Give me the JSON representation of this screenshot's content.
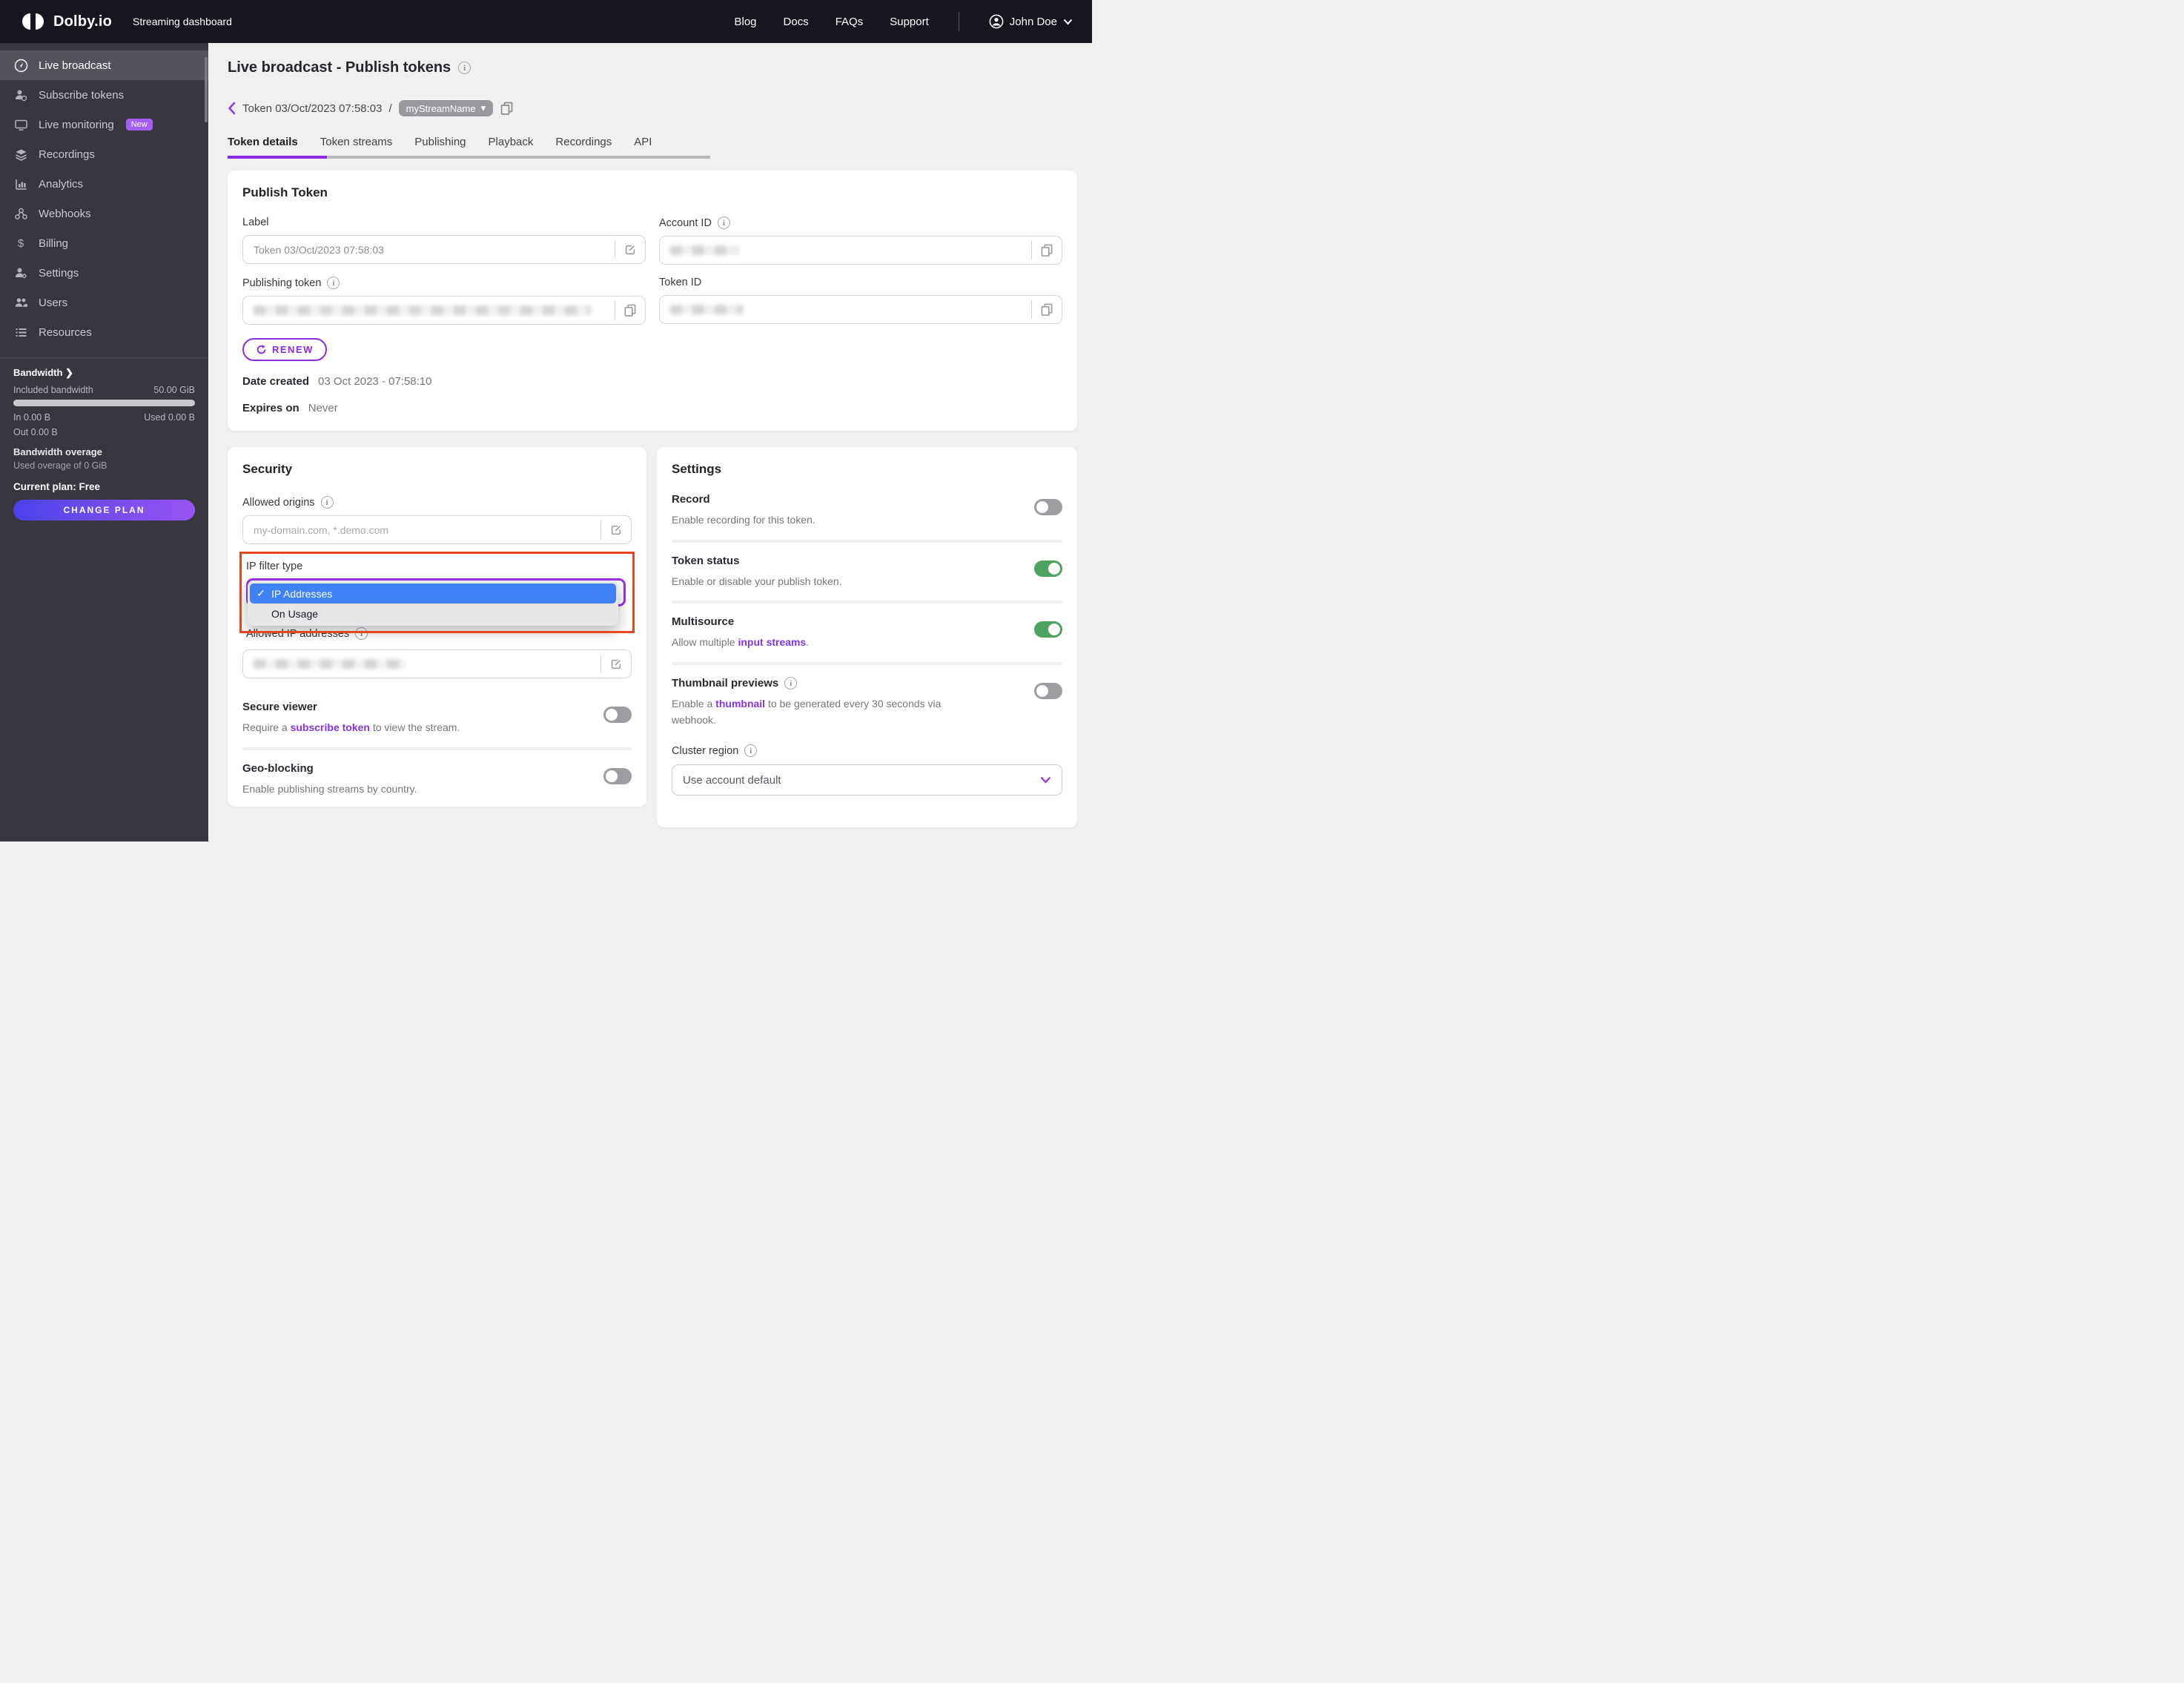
{
  "colors": {
    "accent_purple": "#8a2be2",
    "badge_purple": "#a45cf7",
    "highlight_red": "#e8441d",
    "select_focus_purple": "#9b30e8",
    "dropdown_selected_blue": "#3f82f7",
    "toggle_on_green": "#4da35f",
    "toggle_off_gray": "#9d9da1",
    "header_bg": "#17151d",
    "sidebar_bg": "#393640"
  },
  "icons": {
    "check": "✓",
    "caret_down": "▾",
    "dollar": "$"
  },
  "header": {
    "brand": "Dolby.io",
    "subtitle": "Streaming dashboard",
    "nav": [
      {
        "label": "Blog"
      },
      {
        "label": "Docs"
      },
      {
        "label": "FAQs"
      },
      {
        "label": "Support"
      }
    ],
    "user": "John Doe"
  },
  "sidebar": {
    "items": [
      {
        "label": "Live broadcast",
        "icon": "broadcast-icon",
        "active": true
      },
      {
        "label": "Subscribe tokens",
        "icon": "person-shield-icon"
      },
      {
        "label": "Live monitoring",
        "icon": "monitor-icon",
        "badge": "New"
      },
      {
        "label": "Recordings",
        "icon": "layers-icon"
      },
      {
        "label": "Analytics",
        "icon": "bar-chart-icon"
      },
      {
        "label": "Webhooks",
        "icon": "webhook-icon"
      },
      {
        "label": "Billing",
        "icon": "dollar-icon"
      },
      {
        "label": "Settings",
        "icon": "person-gear-icon"
      },
      {
        "label": "Users",
        "icon": "users-icon"
      },
      {
        "label": "Resources",
        "icon": "list-icon"
      }
    ],
    "bandwidth": {
      "title": "Bandwidth",
      "included_label": "Included bandwidth",
      "included_value": "50.00 GiB",
      "in": "In 0.00 B",
      "used": "Used 0.00 B",
      "out": "Out 0.00 B",
      "overage_title": "Bandwidth overage",
      "overage_detail": "Used overage of 0 GiB",
      "plan": "Current plan: Free",
      "change_plan": "CHANGE PLAN"
    }
  },
  "page": {
    "title": "Live broadcast - Publish tokens",
    "breadcrumb": {
      "token": "Token 03/Oct/2023 07:58:03",
      "separator": "/",
      "stream": "myStreamName"
    },
    "tabs": [
      {
        "label": "Token details",
        "active": true
      },
      {
        "label": "Token streams"
      },
      {
        "label": "Publishing"
      },
      {
        "label": "Playback"
      },
      {
        "label": "Recordings"
      },
      {
        "label": "API"
      }
    ]
  },
  "publish_token": {
    "title": "Publish Token",
    "label_label": "Label",
    "label_value": "Token 03/Oct/2023 07:58:03",
    "account_id_label": "Account ID",
    "publishing_token_label": "Publishing token",
    "token_id_label": "Token ID",
    "renew_label": "RENEW",
    "date_created_label": "Date created",
    "date_created_value": "03 Oct 2023 - 07:58:10",
    "expires_label": "Expires on",
    "expires_value": "Never"
  },
  "security": {
    "title": "Security",
    "allowed_origins_label": "Allowed origins",
    "allowed_origins_placeholder": "my-domain.com, *.demo.com",
    "ip_filter_label": "IP filter type",
    "ip_filter": {
      "selected": "IP Addresses",
      "options": [
        "IP Addresses",
        "On Usage"
      ]
    },
    "allowed_ip_label": "Allowed IP addresses",
    "secure_viewer": {
      "title": "Secure viewer",
      "enabled": false,
      "desc_prefix": "Require a ",
      "link": "subscribe token",
      "desc_suffix": " to view the stream."
    },
    "geo_blocking": {
      "title": "Geo-blocking",
      "enabled": false,
      "desc": "Enable publishing streams by country."
    }
  },
  "settings": {
    "title": "Settings",
    "record": {
      "title": "Record",
      "desc": "Enable recording for this token.",
      "enabled": false
    },
    "token_status": {
      "title": "Token status",
      "desc": "Enable or disable your publish token.",
      "enabled": true
    },
    "multisource": {
      "title": "Multisource",
      "enabled": true,
      "desc_prefix": "Allow multiple ",
      "link": "input streams",
      "desc_suffix": "."
    },
    "thumbnails": {
      "title": "Thumbnail previews",
      "enabled": false,
      "desc_prefix": "Enable a ",
      "link": "thumbnail",
      "desc_suffix": " to be generated every 30 seconds via webhook."
    },
    "cluster_region_label": "Cluster region",
    "cluster_region_value": "Use account default"
  }
}
